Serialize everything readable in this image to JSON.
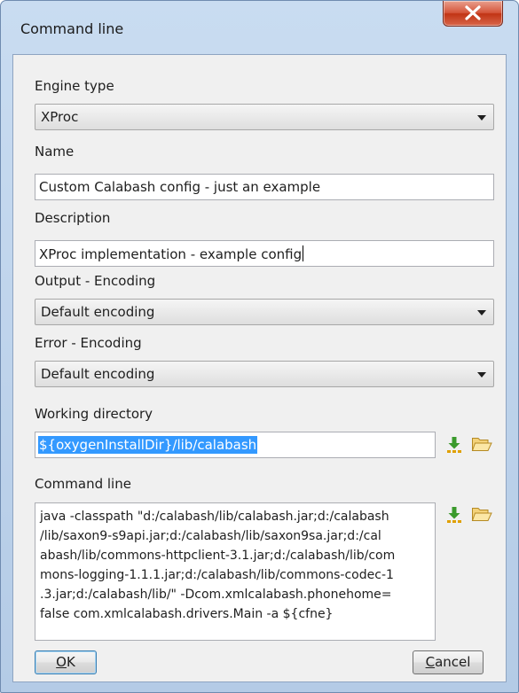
{
  "window": {
    "title": "Command line"
  },
  "engine_type": {
    "label": "Engine type",
    "value": "XProc"
  },
  "name": {
    "label": "Name",
    "value": "Custom Calabash config - just an example"
  },
  "description": {
    "label": "Description",
    "value": "XProc implementation - example config"
  },
  "output_encoding": {
    "label": "Output - Encoding",
    "value": "Default encoding"
  },
  "error_encoding": {
    "label": "Error - Encoding",
    "value": "Default encoding"
  },
  "working_directory": {
    "label": "Working directory",
    "value": "${oxygenInstallDir}/lib/calabash"
  },
  "command_line": {
    "label": "Command line",
    "value": "java -classpath \"d:/calabash/lib/calabash.jar;d:/calabash\n/lib/saxon9-s9api.jar;d:/calabash/lib/saxon9sa.jar;d:/cal\nabash/lib/commons-httpclient-3.1.jar;d:/calabash/lib/com\nmons-logging-1.1.1.jar;d:/calabash/lib/commons-codec-1\n.3.jar;d:/calabash/lib/\" -Dcom.xmlcalabash.phonehome=\nfalse com.xmlcalabash.drivers.Main -a ${cfne}"
  },
  "buttons": {
    "ok_first": "O",
    "ok_rest": "K",
    "cancel_first": "C",
    "cancel_rest": "ancel"
  },
  "icons": {
    "insert_editor_variable": "insert-variable-icon",
    "browse_folder": "folder-open-icon",
    "close": "close-x-icon",
    "dropdown": "chevron-down-icon"
  },
  "colors": {
    "selection": "#3399ff",
    "close_button": "#c13414"
  }
}
